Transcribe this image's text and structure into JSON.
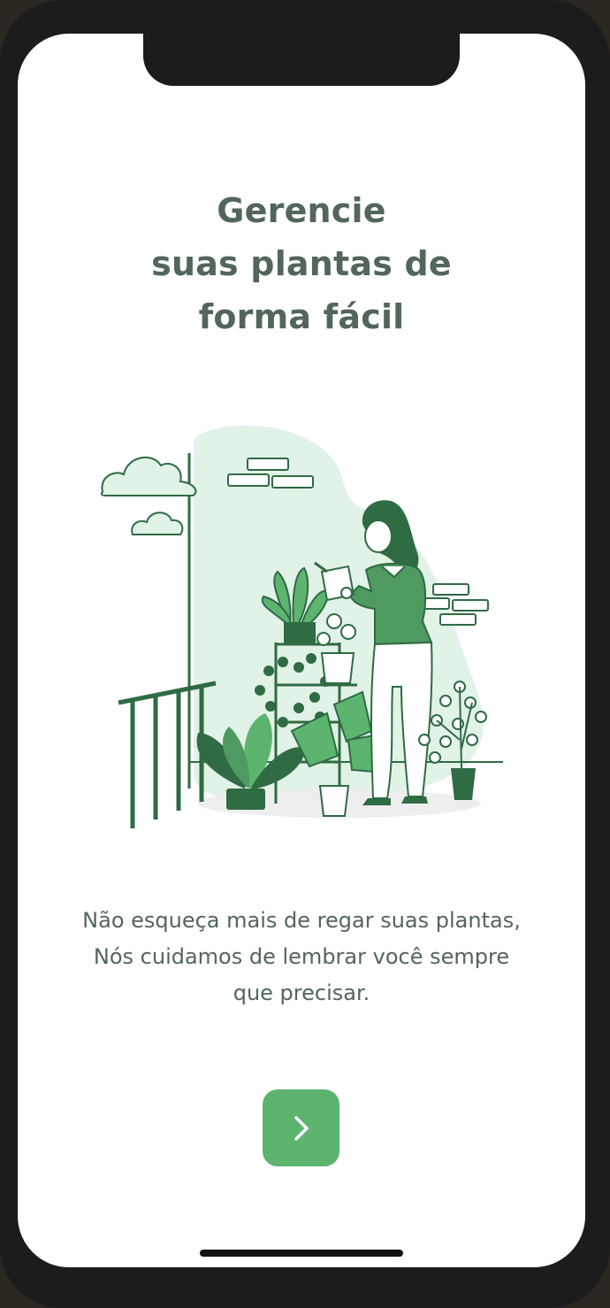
{
  "title": {
    "line1": "Gerencie",
    "line2": "suas plantas de",
    "line3": "forma fácil"
  },
  "description": {
    "line1": "Não esqueça mais de regar suas plantas,",
    "line2": "Nós cuidamos de lembrar você sempre",
    "line3": "que precisar."
  },
  "next_button": {
    "icon": "chevron-right-icon"
  },
  "colors": {
    "title": "#52665a",
    "accent": "#5cb46f",
    "illustration_green": "#2f6b43",
    "illustration_light": "#e1f2e6"
  }
}
